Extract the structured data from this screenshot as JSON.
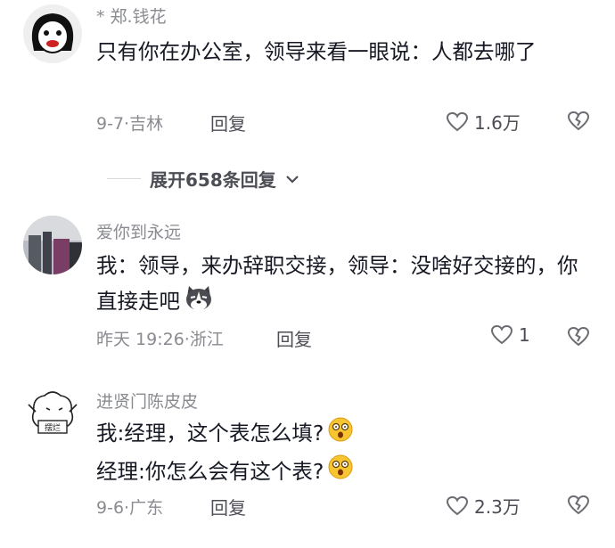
{
  "comments": [
    {
      "author": "* 郑.钱花",
      "text": "只有你在办公室，领导来看一眼说：人都去哪了",
      "date_location": "9-7·吉林",
      "reply_label": "回复",
      "likes": "1.6万"
    },
    {
      "author": "爱你到永远",
      "text": "我：领导，来办辞职交接，领导：没啥好交接的，你直接走吧",
      "date_location": "昨天 19:26·浙江",
      "reply_label": "回复",
      "likes": "1"
    },
    {
      "author": "进贤门陈皮皮",
      "line1": "我:经理，这个表怎么填?",
      "line2": "经理:你怎么会有这个表?",
      "avatar_text": "摆烂",
      "date_location": "9-6·广东",
      "reply_label": "回复",
      "likes": "2.3万"
    }
  ],
  "expand_label": "展开658条回复",
  "icons": {
    "like": "heart-outline-icon",
    "dislike": "broken-heart-icon",
    "expand": "chevron-down-icon"
  }
}
